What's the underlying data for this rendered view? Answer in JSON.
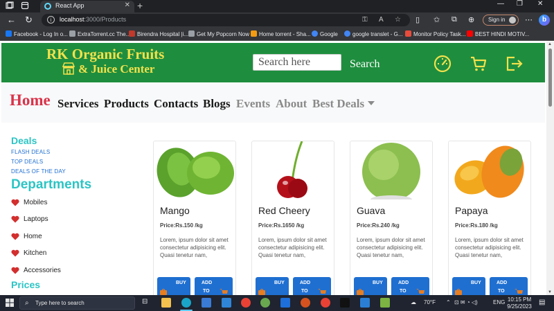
{
  "browser": {
    "tab_title": "React App",
    "url_host": "localhost",
    "url_path": ":3000/Products",
    "signin_label": "Sign in",
    "bookmarks": [
      {
        "label": "Facebook - Log In o...",
        "color": "#1877f2"
      },
      {
        "label": "ExtraTorrent.cc The...",
        "color": "#9aa0a6"
      },
      {
        "label": "Birendra Hospital |i...",
        "color": "#c0392b"
      },
      {
        "label": "Get My Popcorn Now",
        "color": "#9aa0a6"
      },
      {
        "label": "Home torrent - Sha...",
        "color": "#f39c12"
      },
      {
        "label": "Google",
        "color": "#4285f4"
      },
      {
        "label": "google translet - G...",
        "color": "#4285f4"
      },
      {
        "label": "Monitor Policy Task...",
        "color": "#e74c3c"
      },
      {
        "label": "BEST HINDI MOTIV...",
        "color": "#ff0000"
      }
    ]
  },
  "header": {
    "brand_line1": "RK Organic Fruits",
    "brand_line2": "& Juice Center",
    "search_placeholder": "Search here",
    "search_button": "Search",
    "accent": "#1e8e3e",
    "brand_color": "#f2e14c"
  },
  "nav": {
    "home": "Home",
    "items": [
      "Services",
      "Products",
      "Contacts",
      "Blogs"
    ],
    "muted_items": [
      "Events",
      "About",
      "Best Deals"
    ]
  },
  "sidebar": {
    "deals_title": "Deals",
    "deal_links": [
      "FLASH DEALS",
      "TOP DEALS",
      "DEALS OF THE DAY"
    ],
    "departments_title": "Departments",
    "categories": [
      "Mobiles",
      "Laptops",
      "Home",
      "Kitchen",
      "Accessories"
    ],
    "prices_title": "Prices"
  },
  "products": [
    {
      "name": "Mango",
      "price": "Price:Rs.150 /kg",
      "image": "mango-image"
    },
    {
      "name": "Red Cheery",
      "price": "Price:Rs.1650 /kg",
      "image": "cherry-image"
    },
    {
      "name": "Guava",
      "price": "Price:Rs.240 /kg",
      "image": "guava-image"
    },
    {
      "name": "Papaya",
      "price": "Price:Rs.180 /kg",
      "image": "papaya-image"
    }
  ],
  "product_common": {
    "description": "Lorem, ipsum dolor sit amet consectetur adipisicing elit. Quasi tenetur nam,",
    "buy_label": "BUY",
    "add_label_1": "ADD",
    "add_label_2": "TO"
  },
  "taskbar": {
    "search_placeholder": "Type here to search",
    "weather": "70°F",
    "language": "ENG",
    "time": "10:15 PM",
    "date": "9/25/2023"
  }
}
